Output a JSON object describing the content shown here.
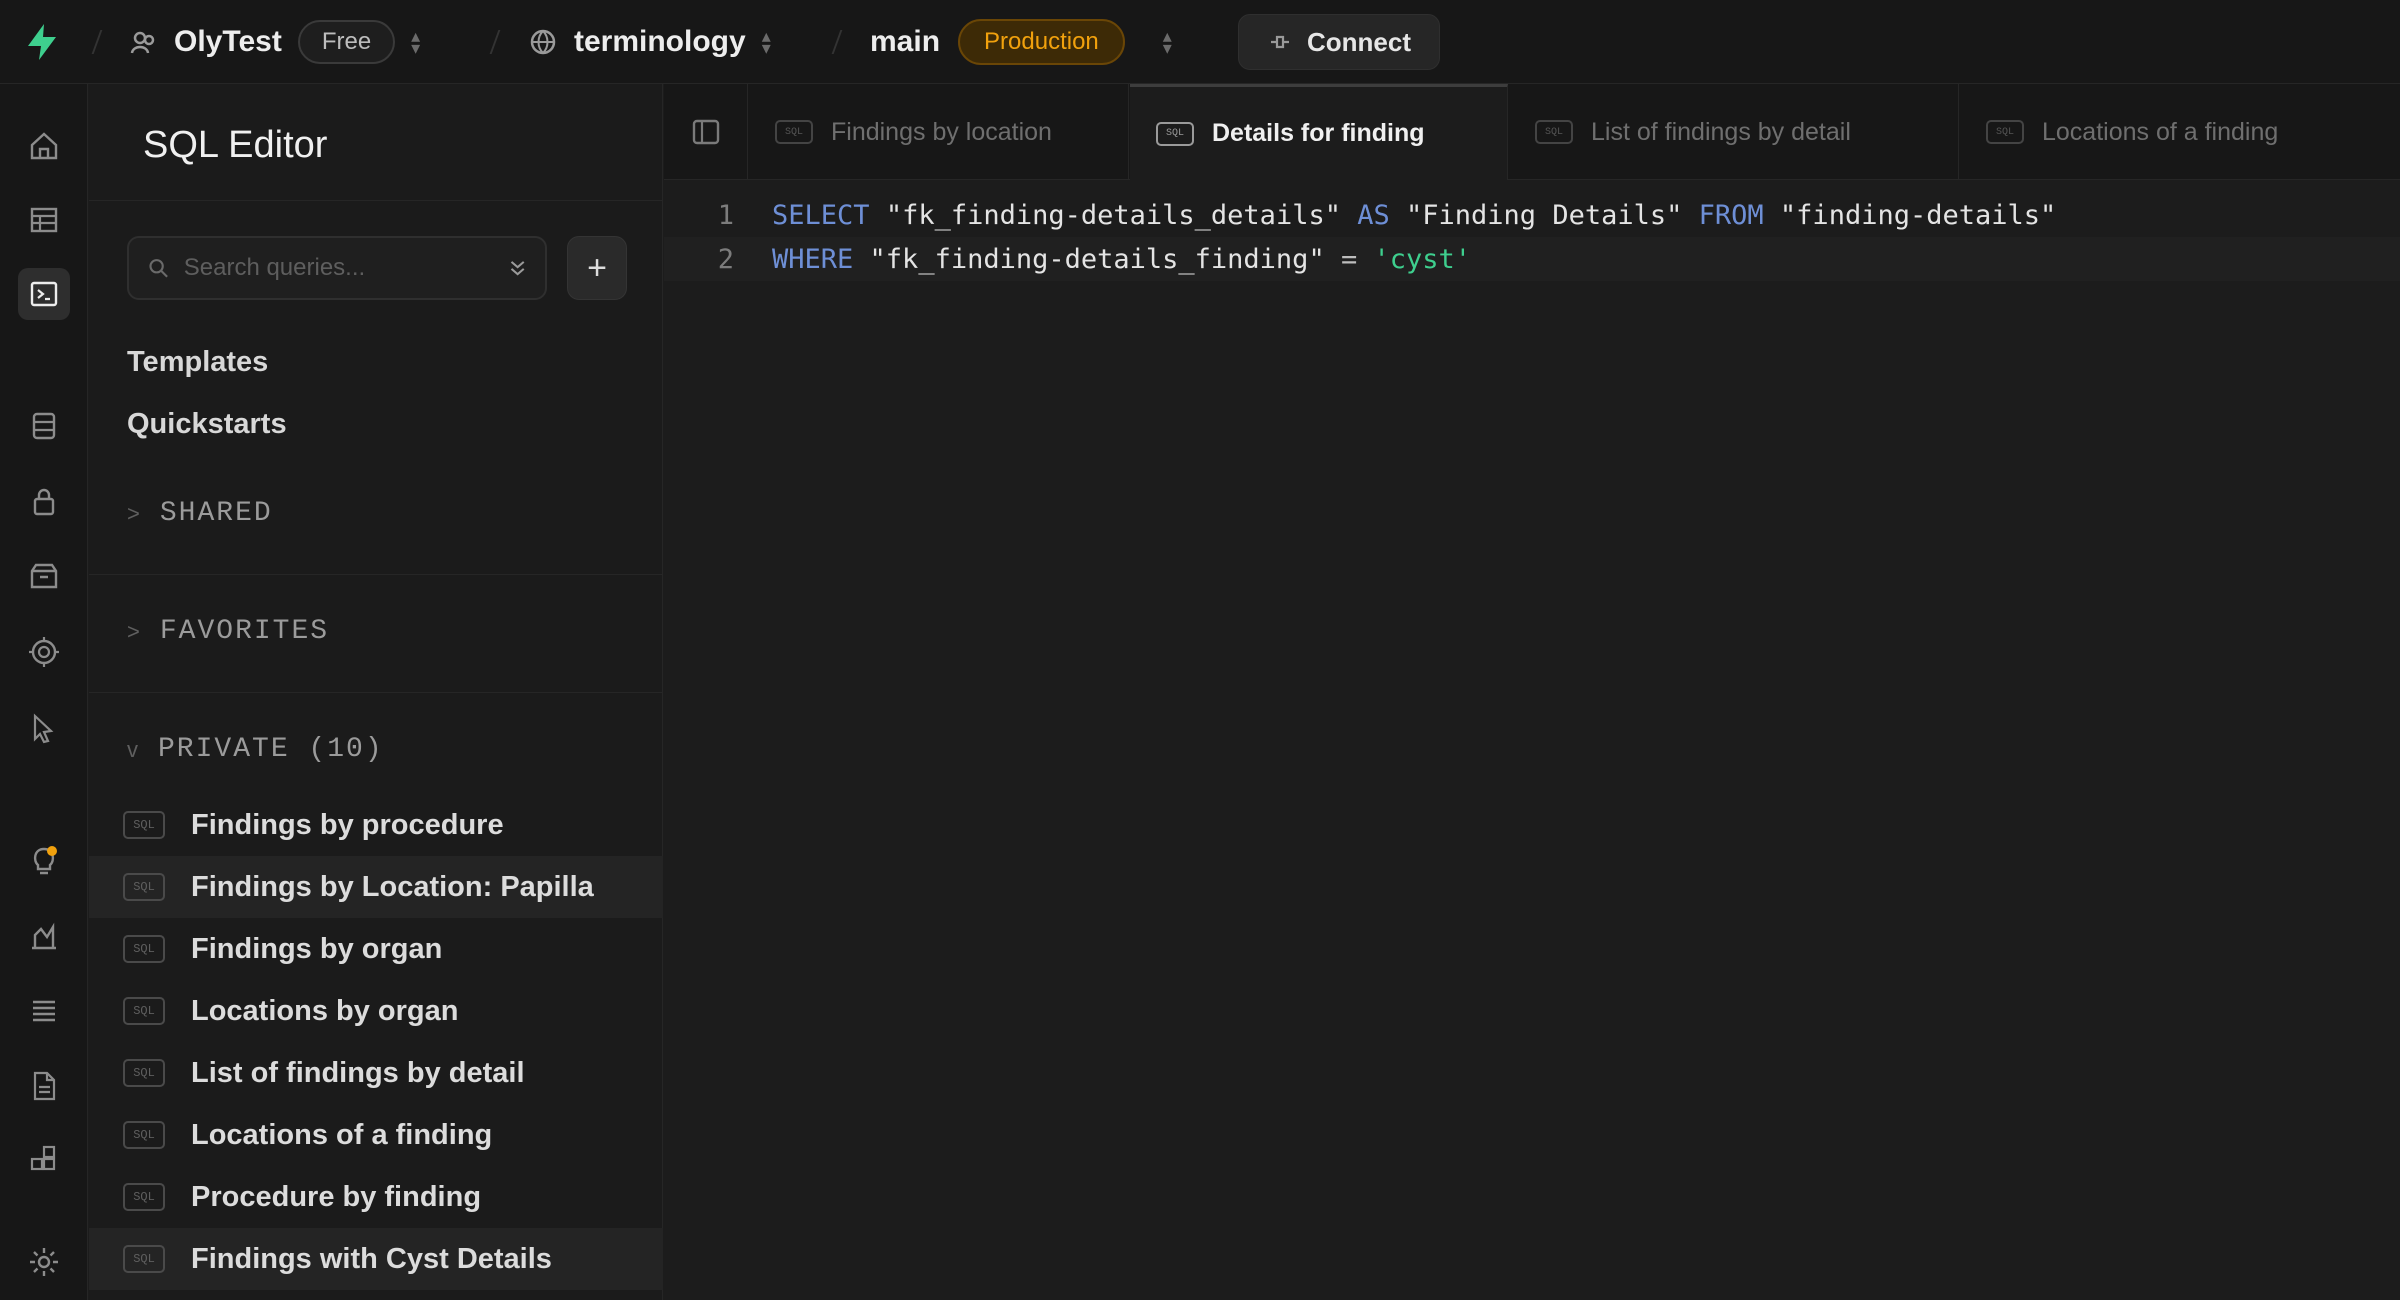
{
  "topbar": {
    "org": "OlyTest",
    "plan": "Free",
    "project": "terminology",
    "branch": "main",
    "environment": "Production",
    "connect_label": "Connect",
    "colors": {
      "brand": "#3ecf8e",
      "production": "#f1a10d"
    }
  },
  "rail": {
    "icons": [
      "home-icon",
      "table-editor-icon",
      "sql-editor-icon",
      "database-icon",
      "auth-lock-icon",
      "storage-icon",
      "edge-functions-icon",
      "realtime-icon",
      "advisors-icon",
      "reports-icon",
      "logs-icon",
      "api-docs-icon",
      "integrations-icon",
      "settings-icon"
    ],
    "active": "sql-editor-icon"
  },
  "sidebar": {
    "title": "SQL Editor",
    "search_placeholder": "Search queries...",
    "links": {
      "templates": "Templates",
      "quickstarts": "Quickstarts"
    },
    "sections": {
      "shared": "SHARED",
      "favorites": "FAVORITES",
      "private": "PRIVATE (10)"
    },
    "queries": [
      "Findings by procedure",
      "Findings by Location: Papilla",
      "Findings by organ",
      "Locations by organ",
      "List of findings by detail",
      "Locations of a finding",
      "Procedure by finding",
      "Findings with Cyst Details"
    ],
    "query_icon_text": "SQL"
  },
  "tabs": [
    {
      "label": "Findings by location"
    },
    {
      "label": "Details for finding"
    },
    {
      "label": "List of findings by detail"
    },
    {
      "label": "Locations of a finding"
    }
  ],
  "active_tab": "Details for finding",
  "editor": {
    "lines": [
      {
        "number": "1",
        "tokens": [
          "SELECT",
          " ",
          "\"fk_finding-details_details\"",
          " ",
          "AS",
          " ",
          "\"Finding Details\"",
          " ",
          "FROM",
          " ",
          "\"finding-details\""
        ]
      },
      {
        "number": "2",
        "tokens": [
          "WHERE",
          " ",
          "\"fk_finding-details_finding\"",
          " ",
          "=",
          " ",
          "'cyst'"
        ]
      }
    ]
  }
}
